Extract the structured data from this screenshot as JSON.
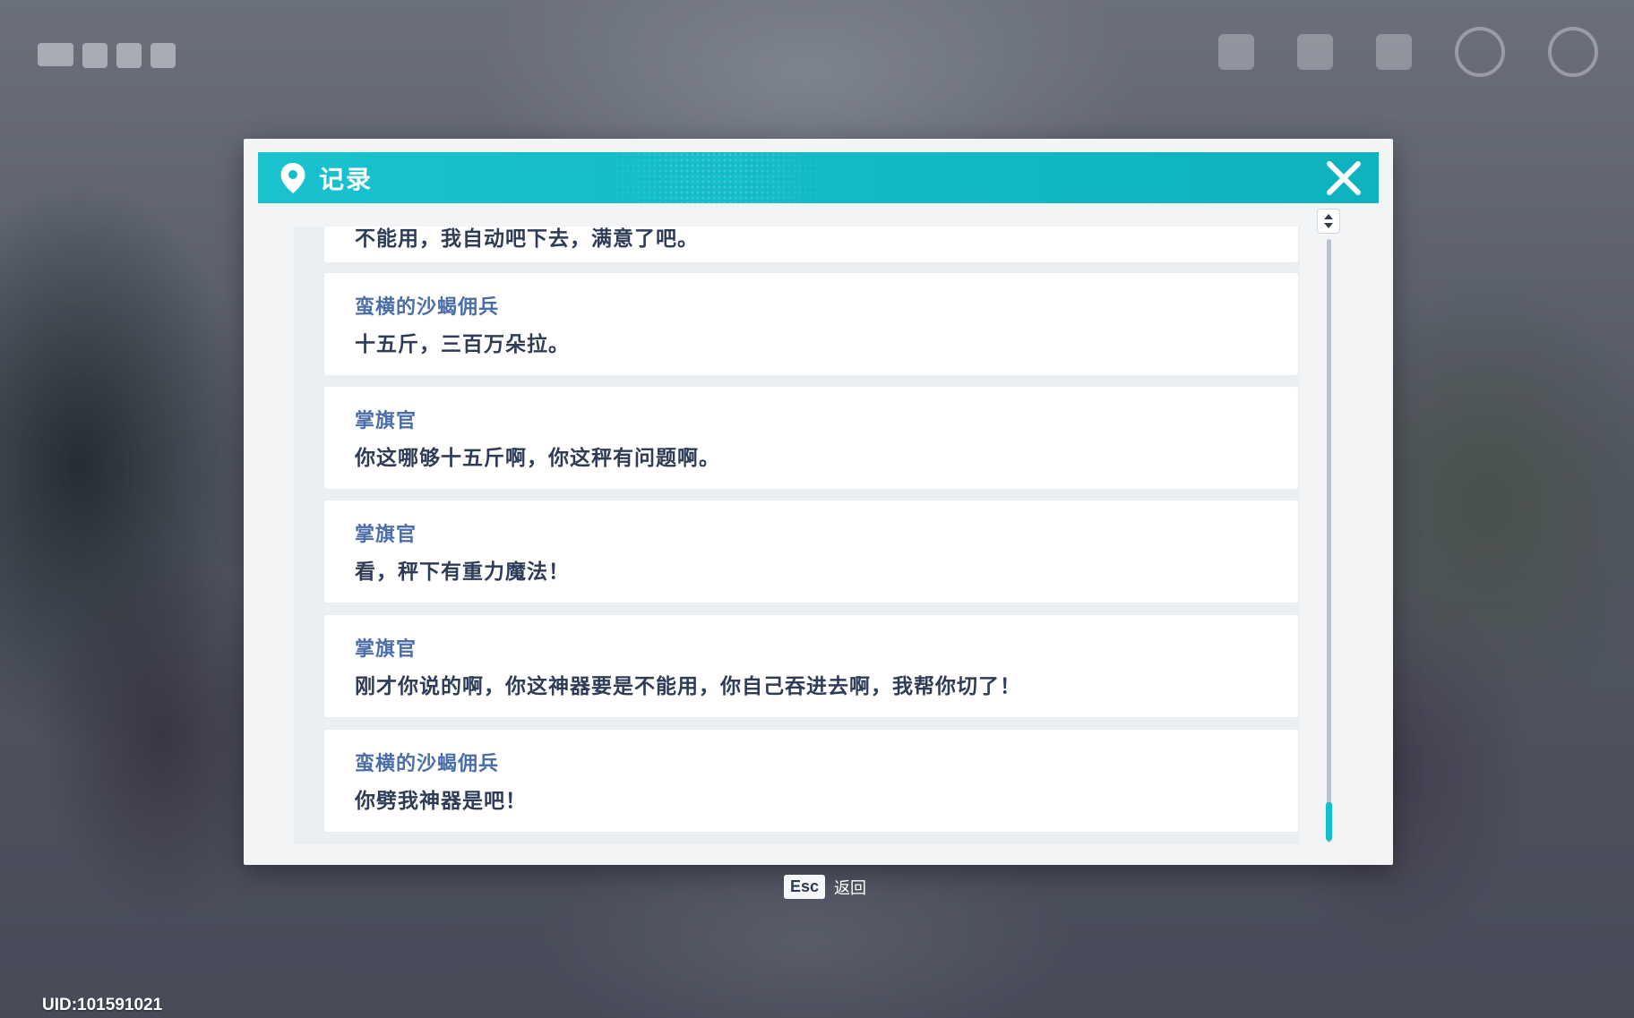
{
  "dialog": {
    "title": "记录",
    "icon": "map-pin-icon",
    "close_icon": "close-icon",
    "accent": "#12bcc8"
  },
  "log": {
    "partial_top_line": "不能用，我自动吧下去，满意了吧。",
    "entries": [
      {
        "speaker": "蛮横的沙蝎佣兵",
        "line": "十五斤，三百万朵拉。"
      },
      {
        "speaker": "掌旗官",
        "line": "你这哪够十五斤啊，你这秤有问题啊。"
      },
      {
        "speaker": "掌旗官",
        "line": "看，秤下有重力魔法！"
      },
      {
        "speaker": "掌旗官",
        "line": "刚才你说的啊，你这神器要是不能用，你自己吞进去啊，我帮你切了！"
      },
      {
        "speaker": "蛮横的沙蝎佣兵",
        "line": "你劈我神器是吧！"
      }
    ],
    "speaker_color": "#4b6ea8",
    "text_color": "#2e3c57"
  },
  "footer": {
    "esc_key": "Esc",
    "esc_label": "返回"
  },
  "uid": "UID:101591021"
}
